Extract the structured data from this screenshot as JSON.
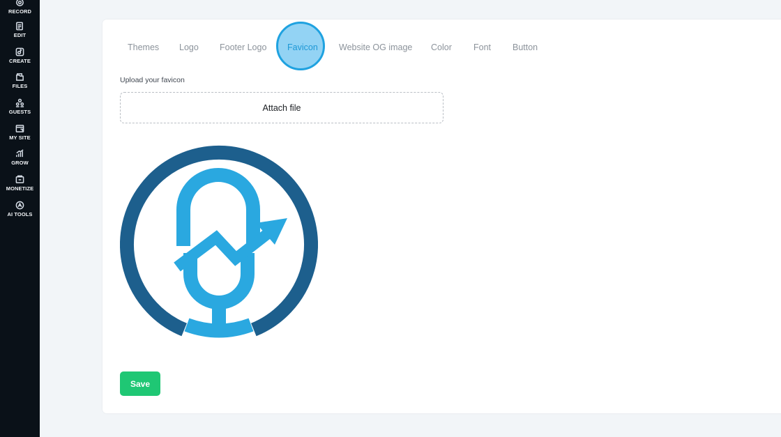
{
  "sidebar": {
    "items": [
      {
        "label": "RECORD",
        "icon": "record-icon"
      },
      {
        "label": "EDIT",
        "icon": "edit-icon"
      },
      {
        "label": "CREATE",
        "icon": "create-icon"
      },
      {
        "label": "FILES",
        "icon": "files-icon"
      },
      {
        "label": "GUESTS",
        "icon": "guests-icon"
      },
      {
        "label": "MY SITE",
        "icon": "my-site-icon"
      },
      {
        "label": "GROW",
        "icon": "grow-icon"
      },
      {
        "label": "MONETIZE",
        "icon": "monetize-icon"
      },
      {
        "label": "AI TOOLS",
        "icon": "ai-tools-icon"
      }
    ]
  },
  "tabs": [
    {
      "label": "Themes"
    },
    {
      "label": "Logo"
    },
    {
      "label": "Footer Logo"
    },
    {
      "label": "Favicon",
      "active": true
    },
    {
      "label": "Website OG image"
    },
    {
      "label": "Color"
    },
    {
      "label": "Font"
    },
    {
      "label": "Button"
    }
  ],
  "upload": {
    "label": "Upload your favicon",
    "attach_label": "Attach file"
  },
  "save_label": "Save",
  "colors": {
    "ring": "#1d5f8d",
    "mic": "#2aa8e0",
    "save": "#1fc774",
    "active_tab": "#1e98d6"
  }
}
